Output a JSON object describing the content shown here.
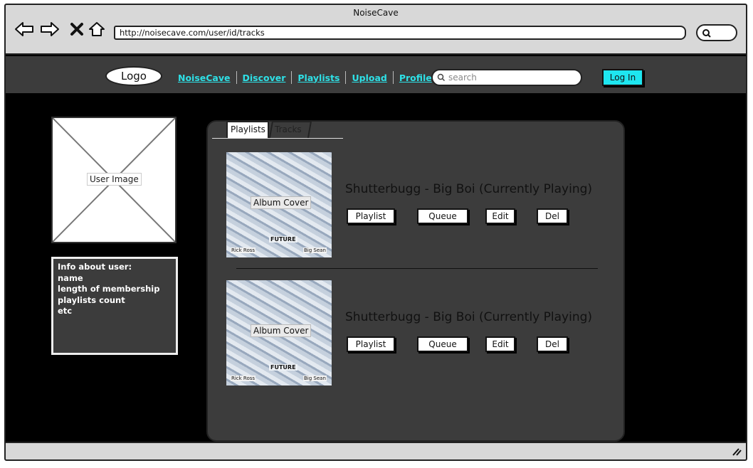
{
  "browser": {
    "title": "NoiseCave",
    "url": "http://noisecave.com/user/id/tracks"
  },
  "header": {
    "logo": "Logo",
    "nav": [
      "NoiseCave",
      "Discover",
      "Playlists",
      "Upload",
      "Profile"
    ],
    "search_placeholder": "search",
    "login_label": "Log In",
    "accent_color": "#1ee6f0"
  },
  "user": {
    "image_label": "User Image",
    "info_lines": [
      "Info about user:",
      "name",
      "length of membership",
      "playlists count",
      "etc"
    ]
  },
  "tabs": [
    "Playlists",
    "Tracks"
  ],
  "tracks": [
    {
      "cover_label": "Album Cover",
      "cover_text": "FUTURE",
      "cover_left": "Rick Ross",
      "cover_right": "Big Sean",
      "title": "Shutterbugg - Big Boi (Currently Playing)",
      "buttons": [
        "Playlist",
        "Queue",
        "Edit",
        "Del"
      ]
    },
    {
      "cover_label": "Album Cover",
      "cover_text": "FUTURE",
      "cover_left": "Rick Ross",
      "cover_right": "Big Sean",
      "title": "Shutterbugg - Big Boi (Currently Playing)",
      "buttons": [
        "Playlist",
        "Queue",
        "Edit",
        "Del"
      ]
    }
  ]
}
